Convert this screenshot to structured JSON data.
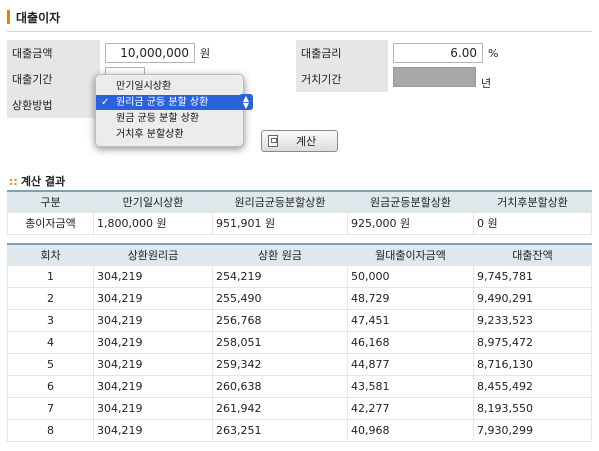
{
  "page": {
    "title": "대출이자"
  },
  "form": {
    "amount_label": "대출금액",
    "amount_value": "10,000,000",
    "amount_unit": "원",
    "rate_label": "대출금리",
    "rate_value": "6.00",
    "rate_unit": "%",
    "period_label": "대출기간",
    "period_unit": "년",
    "grace_label": "거치기간",
    "grace_unit": "년",
    "method_label": "상환방법",
    "method_options": [
      "만기일시상환",
      "원리금 균등 분할 상환",
      "원금 균등 분할 상환",
      "거치후 분할상환"
    ],
    "method_selected_index": 1,
    "calc_label": "계산"
  },
  "result": {
    "section_title": "계산 결과",
    "headers": [
      "구분",
      "만기일시상환",
      "원리금균등분할상환",
      "원금균등분할상환",
      "거치후분할상환"
    ],
    "row_label": "총이자금액",
    "values": [
      "1,800,000 원",
      "951,901 원",
      "925,000 원",
      "0 원"
    ]
  },
  "schedule": {
    "headers": [
      "회차",
      "상환원리금",
      "상환 원금",
      "월대출이자금액",
      "대출잔액"
    ],
    "rows": [
      [
        "1",
        "304,219",
        "254,219",
        "50,000",
        "9,745,781"
      ],
      [
        "2",
        "304,219",
        "255,490",
        "48,729",
        "9,490,291"
      ],
      [
        "3",
        "304,219",
        "256,768",
        "47,451",
        "9,233,523"
      ],
      [
        "4",
        "304,219",
        "258,051",
        "46,168",
        "8,975,472"
      ],
      [
        "5",
        "304,219",
        "259,342",
        "44,877",
        "8,716,130"
      ],
      [
        "6",
        "304,219",
        "260,638",
        "43,581",
        "8,455,492"
      ],
      [
        "7",
        "304,219",
        "261,942",
        "42,277",
        "8,193,550"
      ],
      [
        "8",
        "304,219",
        "263,251",
        "40,968",
        "7,930,299"
      ]
    ]
  },
  "colors": {
    "accent": "#f07c00",
    "header_bg": "#dfe8ec",
    "label_bg": "#e6e6e6",
    "selection": "#2a62d9"
  }
}
